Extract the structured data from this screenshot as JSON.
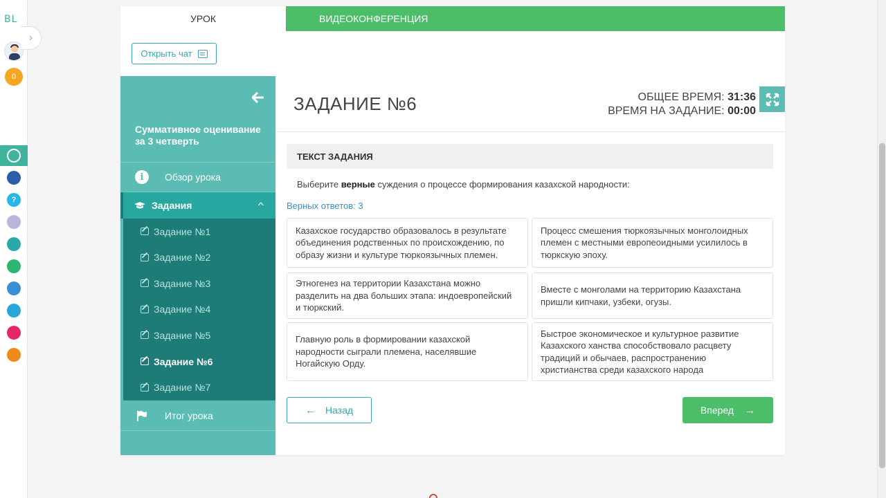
{
  "rail": {
    "logo": "BL",
    "badge_count": "0",
    "apps": [
      {
        "icon": "app-active-icon",
        "color": "#ffffff"
      },
      {
        "icon": "smart-icon",
        "color": "#2b5ea7"
      },
      {
        "icon": "help-icon",
        "color": "#29b6e9",
        "glyph": "?"
      },
      {
        "icon": "card-icon",
        "color": "#b7b7d9"
      },
      {
        "icon": "bilim-app-icon",
        "color": "#2aa9a9"
      },
      {
        "icon": "bilim-land-icon",
        "color": "#2cb673"
      },
      {
        "icon": "bilim-book-icon",
        "color": "#3a8fd4"
      },
      {
        "icon": "checklist-icon",
        "color": "#29a7d6"
      },
      {
        "icon": "twig-icon",
        "color": "#e52765"
      },
      {
        "icon": "orange-app-icon",
        "color": "#f08a1a"
      }
    ]
  },
  "tabs": {
    "lesson": "УРОК",
    "video": "ВИДЕОКОНФЕРЕНЦИЯ"
  },
  "chat_button": "Открыть чат",
  "sidebar": {
    "title": "Суммативное оценивание за 3 четверть",
    "overview": "Обзор урока",
    "tasks": "Задания",
    "items": [
      {
        "label": "Задание №1",
        "active": false
      },
      {
        "label": "Задание №2",
        "active": false
      },
      {
        "label": "Задание №3",
        "active": false
      },
      {
        "label": "Задание №4",
        "active": false
      },
      {
        "label": "Задание №5",
        "active": false
      },
      {
        "label": "Задание №6",
        "active": true
      },
      {
        "label": "Задание №7",
        "active": false
      }
    ],
    "result": "Итог урока"
  },
  "task": {
    "title": "ЗАДАНИЕ №6",
    "total_time_label": "ОБЩЕЕ ВРЕМЯ:",
    "total_time": "31:36",
    "task_time_label": "ВРЕМЯ НА ЗАДАНИЕ:",
    "task_time": "00:00",
    "section_header": "ТЕКСТ ЗАДАНИЯ",
    "text_before": "Выберите ",
    "text_bold": "верные",
    "text_after": " суждения о процессе формирования казахской народности:",
    "correct_answers": "Верных ответов: 3",
    "options": [
      "Казахское государство образовалось в результате объединения родственных по происхождению, по образу жизни и культуре тюркоязычных племен.",
      "Процесс смешения тюркоязычных монголоидных племен с местными европеоидными усилилось в тюркскую эпоху.",
      "Этногенез на территории Казахстана можно разделить на два больших этапа: индоевропейский и тюркский.",
      "Вместе с монголами на территорию Казахстана пришли кипчаки, узбеки, огузы.",
      "Главную роль в формировании казахской народности сыграли племена, населявшие Ногайскую Орду.",
      "Быстрое экономическое и культурное развитие Казахского ханства способствовало расцвету традиций и обычаев, распространению христианства среди казахского народа"
    ]
  },
  "nav": {
    "back": "Назад",
    "next": "Вперед"
  },
  "colors": {
    "accent_green": "#4cbd68",
    "sidebar_teal": "#5bbcb4",
    "sidebar_dark": "#1d7c77",
    "link_blue": "#3a8fc4"
  }
}
